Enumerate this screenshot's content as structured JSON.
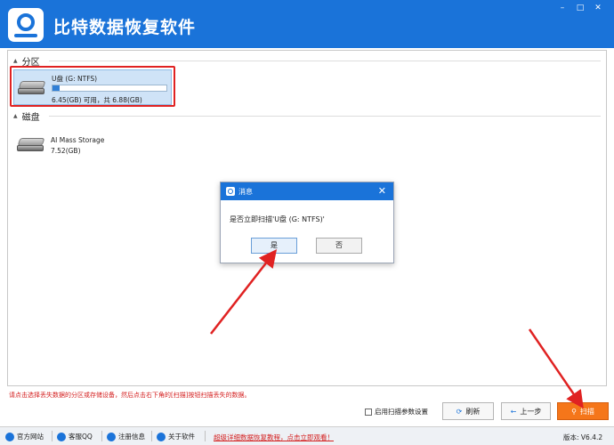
{
  "app": {
    "title": "比特数据恢复软件"
  },
  "window_controls": {
    "minimize": "–",
    "maximize": "□",
    "close": "✕"
  },
  "sections": {
    "partition": {
      "label": "分区",
      "drives": [
        {
          "name": "U盘 (G: NTFS)",
          "size": "6.45(GB) 可用，共 6.88(GB)",
          "used_fraction": 0.06
        }
      ]
    },
    "disk": {
      "label": "磁盘",
      "drives": [
        {
          "name": "AI Mass Storage",
          "size": "7.52(GB)"
        }
      ]
    }
  },
  "dialog": {
    "title": "消息",
    "close": "✕",
    "message": "是否立即扫描'U盘 (G: NTFS)'",
    "yes": "是",
    "no": "否"
  },
  "hint": "请点击选择丢失数据的分区或存储设备，然后点击右下角的[扫描]按钮扫描丢失的数据。",
  "actions": {
    "scan_settings": "启用扫描参数设置",
    "refresh": "刷新",
    "prev": "上一步",
    "scan": "扫描"
  },
  "statusbar": {
    "items": [
      "官方网站",
      "客服QQ",
      "注册信息",
      "关于软件"
    ],
    "promo": "超级详细数据恢复教程，点击立即观看！",
    "version": "版本: V6.4.2"
  },
  "colors": {
    "brand": "#1a73d9",
    "accent": "#f5761a",
    "annotation": "#e02222"
  }
}
